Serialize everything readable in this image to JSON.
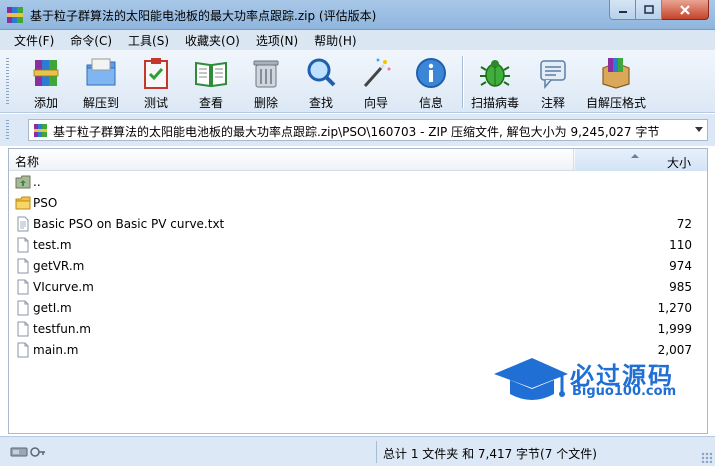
{
  "window": {
    "title": "基于粒子群算法的太阳能电池板的最大功率点跟踪.zip (评估版本)"
  },
  "menu": [
    "文件(F)",
    "命令(C)",
    "工具(S)",
    "收藏夹(O)",
    "选项(N)",
    "帮助(H)"
  ],
  "toolbar": {
    "add": "添加",
    "extract_to": "解压到",
    "test": "测试",
    "view": "查看",
    "delete": "删除",
    "find": "查找",
    "wizard": "向导",
    "info": "信息",
    "virus_scan": "扫描病毒",
    "comment": "注释",
    "sfx": "自解压格式"
  },
  "address": {
    "path": "基于粒子群算法的太阳能电池板的最大功率点跟踪.zip\\PSO\\160703 - ZIP 压缩文件, 解包大小为 9,245,027 字节"
  },
  "columns": {
    "name": "名称",
    "size": "大小"
  },
  "files": [
    {
      "name": "..",
      "size": "",
      "icon": "parent-folder-icon"
    },
    {
      "name": "PSO",
      "size": "",
      "icon": "folder-icon"
    },
    {
      "name": "Basic PSO on Basic PV curve.txt",
      "size": "72",
      "icon": "text-file-icon"
    },
    {
      "name": "test.m",
      "size": "110",
      "icon": "file-icon"
    },
    {
      "name": "getVR.m",
      "size": "974",
      "icon": "file-icon"
    },
    {
      "name": "VIcurve.m",
      "size": "985",
      "icon": "file-icon"
    },
    {
      "name": "getI.m",
      "size": "1,270",
      "icon": "file-icon"
    },
    {
      "name": "testfun.m",
      "size": "1,999",
      "icon": "file-icon"
    },
    {
      "name": "main.m",
      "size": "2,007",
      "icon": "file-icon"
    }
  ],
  "watermark": {
    "title": "必过源码",
    "subtitle": "Biguo100.com"
  },
  "status": {
    "text": "总计 1 文件夹 和 7,417 字节(7 个文件)"
  },
  "colors": {
    "accent": "#1f6fd4",
    "close_button": "#c7432a"
  }
}
